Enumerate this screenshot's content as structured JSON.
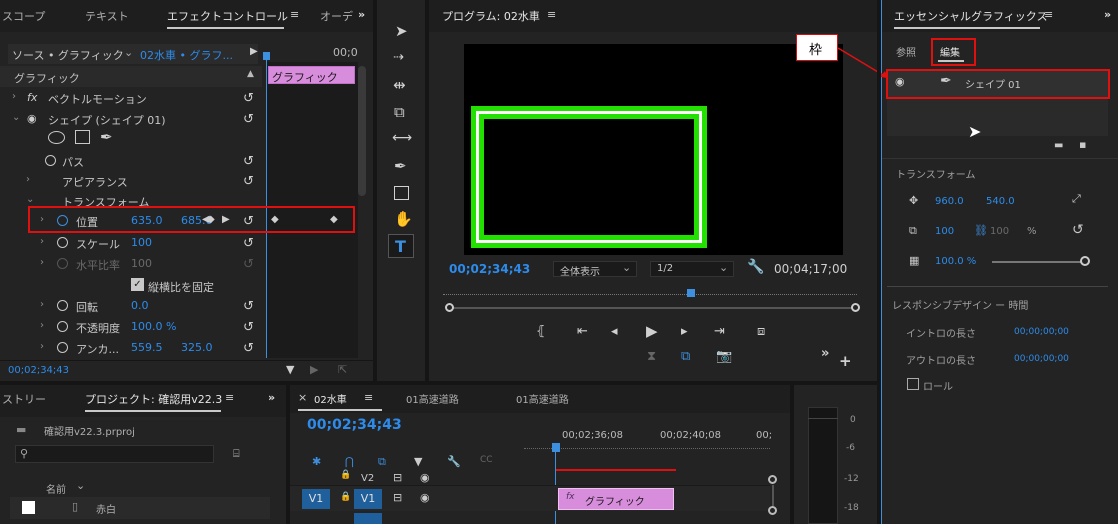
{
  "effect_controls": {
    "tabs": [
      "スコープ",
      "テキスト",
      "エフェクトコントロール",
      "オーデ"
    ],
    "source_label": "ソース • グラフィック",
    "clip_label": "02水車 • グラフ...",
    "timeline_marker": "00;0",
    "clip_bar_label": "グラフィック",
    "section_header": "グラフィック",
    "vector_motion": "ベクトルモーション",
    "shape_label": "シェイプ (シェイプ 01)",
    "path_label": "パス",
    "appearance_label": "アピアランス",
    "transform_label": "トランスフォーム",
    "position_label": "位置",
    "position_x": "635.0",
    "position_y": "685.0",
    "scale_label": "スケール",
    "scale_value": "100",
    "scale_width_label": "水平比率",
    "scale_width_value": "100",
    "uniform_scale_label": "縦横比を固定",
    "rotation_label": "回転",
    "rotation_value": "0.0",
    "opacity_label": "不透明度",
    "opacity_value": "100.0 %",
    "anchor_label": "アンカ...",
    "anchor_x": "559.5",
    "anchor_y": "325.0",
    "timecode": "00;02;34;43"
  },
  "program_monitor": {
    "title": "プログラム: 02水車",
    "timecode": "00;02;34;43",
    "fit_label": "全体表示",
    "resolution": "1/2",
    "duration": "00;04;17;00"
  },
  "essential_graphics": {
    "title": "エッセンシャルグラフィックス",
    "tab_browse": "参照",
    "tab_edit": "編集",
    "layer_name": "シェイプ 01",
    "transform_header": "トランスフォーム",
    "pos_x": "960.0",
    "pos_y": "540.0",
    "scale": "100",
    "scale_locked": "100",
    "percent": "%",
    "opacity": "100.0 %",
    "responsive_header": "レスポンシブデザイン ー 時間",
    "intro_label": "イントロの長さ",
    "intro_value": "00;00;00;00",
    "outro_label": "アウトロの長さ",
    "outro_value": "00;00;00;00",
    "roll_label": "ロール",
    "callout_label": "枠"
  },
  "project": {
    "tab_history": "ストリー",
    "tab_project": "プロジェクト: 確認用v22.3",
    "file_name": "確認用v22.3.prproj",
    "column_name": "名前",
    "item_name": "赤白"
  },
  "timeline": {
    "tabs": [
      "02水車",
      "01高速道路",
      "01高速道路"
    ],
    "timecode": "00;02;34;43",
    "ruler": [
      "00;02;36;08",
      "00;02;40;08",
      "00;"
    ],
    "track_v2": "V2",
    "track_v1": "V1",
    "clip_label": "グラフィック"
  },
  "audio_meter": {
    "labels": [
      "0",
      "-6",
      "-12",
      "-18"
    ]
  }
}
